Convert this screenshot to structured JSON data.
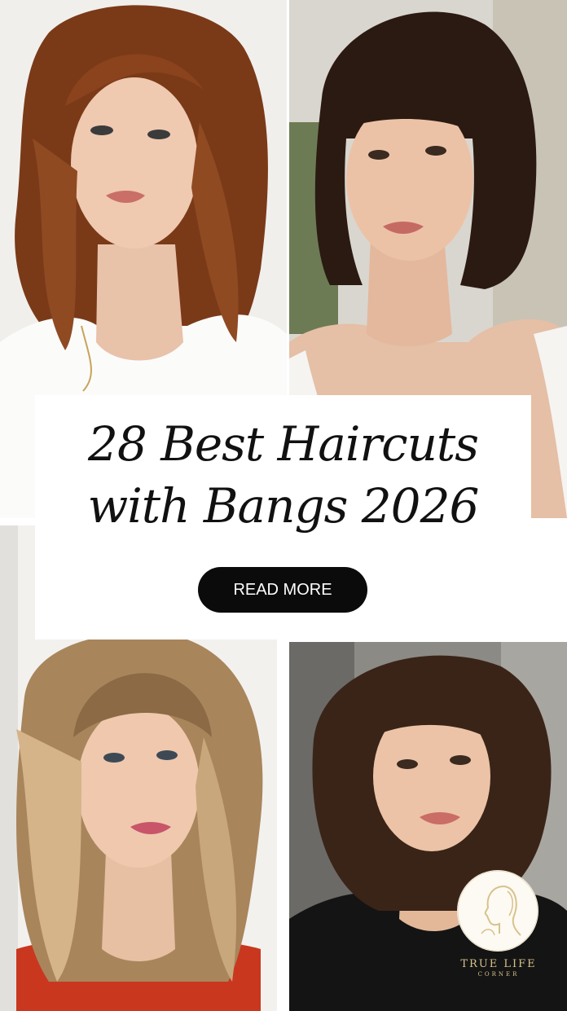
{
  "title": {
    "line1": "28 Best Haircuts",
    "line2": "with Bangs 2026"
  },
  "cta": {
    "label": "READ MORE"
  },
  "logo": {
    "brand_line1": "TRUE LIFE",
    "brand_line2": "CORNER",
    "icon": "woman-profile-icon"
  },
  "colors": {
    "background": "#ffffff",
    "title_text": "#111111",
    "button_bg": "#0b0b0b",
    "button_text": "#ffffff",
    "logo_gold": "#d7c28c"
  },
  "photos": [
    {
      "name": "woman-auburn-wavy-shag-bangs",
      "hair_color": "#7a3a18"
    },
    {
      "name": "woman-dark-bob-bangs",
      "hair_color": "#2b1a12"
    },
    {
      "name": "woman-blonde-balayage-layers-bangs",
      "hair_color": "#a9855c"
    },
    {
      "name": "woman-brunette-wavy-bob-bangs",
      "hair_color": "#3a2418"
    }
  ]
}
